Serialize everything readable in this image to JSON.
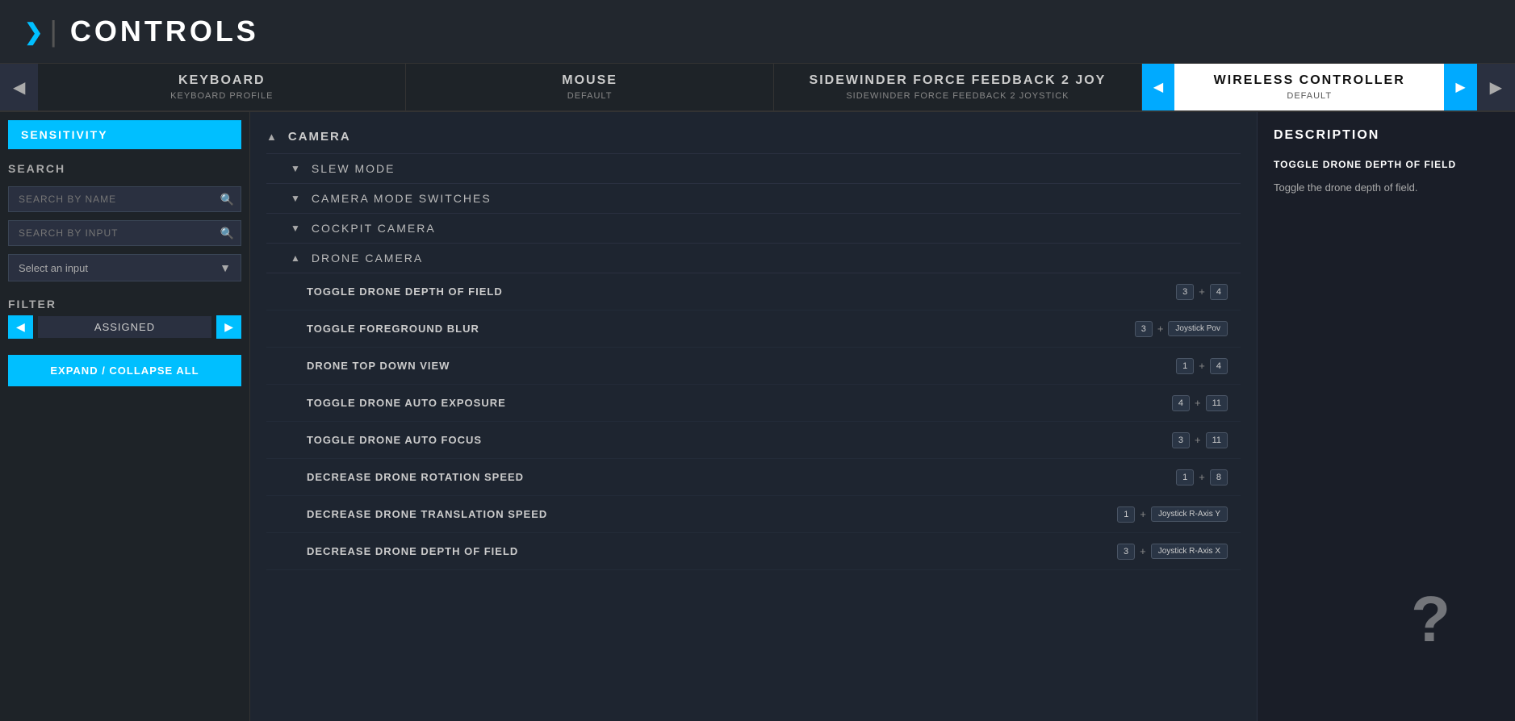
{
  "header": {
    "chevron": "❯",
    "divider": "|",
    "title": "CONTROLS"
  },
  "tabs": [
    {
      "id": "keyboard",
      "name": "KEYBOARD",
      "sub": "KEYBOARD PROFILE",
      "active": false
    },
    {
      "id": "mouse",
      "name": "MOUSE",
      "sub": "DEFAULT",
      "active": false
    },
    {
      "id": "sidewinder",
      "name": "SIDEWINDER FORCE FEEDBACK 2 JOY",
      "sub": "SIDEWINDER FORCE FEEDBACK 2 JOYSTICK",
      "active": false
    },
    {
      "id": "wireless",
      "name": "WIRELESS CONTROLLER",
      "sub": "DEFAULT",
      "active": true
    }
  ],
  "sidebar": {
    "sensitivity_label": "SENSITIVITY",
    "search_label": "SEARCH",
    "search_by_name_placeholder": "SEARCH BY NAME",
    "search_by_input_placeholder": "SEARCH BY INPUT",
    "select_input_placeholder": "Select an input",
    "filter_label": "FILTER",
    "filter_value": "ASSIGNED",
    "expand_label": "EXPAND / COLLAPSE ALL"
  },
  "categories": [
    {
      "name": "CAMERA",
      "expanded": true,
      "subcategories": [
        {
          "name": "SLEW MODE",
          "expanded": false,
          "items": []
        },
        {
          "name": "CAMERA MODE SWITCHES",
          "expanded": false,
          "items": []
        },
        {
          "name": "COCKPIT CAMERA",
          "expanded": false,
          "items": []
        },
        {
          "name": "DRONE CAMERA",
          "expanded": true,
          "items": [
            {
              "name": "TOGGLE DRONE DEPTH OF FIELD",
              "binding1": "3",
              "plus": "+",
              "binding2": "4",
              "binding2_wide": false
            },
            {
              "name": "TOGGLE FOREGROUND BLUR",
              "binding1": "3",
              "plus": "+",
              "binding2": "Joystick Pov",
              "binding2_wide": true
            },
            {
              "name": "DRONE TOP DOWN VIEW",
              "binding1": "1",
              "plus": "+",
              "binding2": "4",
              "binding2_wide": false
            },
            {
              "name": "TOGGLE DRONE AUTO EXPOSURE",
              "binding1": "4",
              "plus": "+",
              "binding2": "11",
              "binding2_wide": false
            },
            {
              "name": "TOGGLE DRONE AUTO FOCUS",
              "binding1": "3",
              "plus": "+",
              "binding2": "11",
              "binding2_wide": false
            },
            {
              "name": "DECREASE DRONE ROTATION SPEED",
              "binding1": "1",
              "plus": "+",
              "binding2": "8",
              "binding2_wide": false
            },
            {
              "name": "DECREASE DRONE TRANSLATION SPEED",
              "binding1": "1",
              "plus": "+",
              "binding2": "Joystick R-Axis Y",
              "binding2_wide": true
            },
            {
              "name": "DECREASE DRONE DEPTH OF FIELD",
              "binding1": "3",
              "plus": "+",
              "binding2": "Joystick R-Axis X",
              "binding2_wide": true
            }
          ]
        }
      ]
    }
  ],
  "description": {
    "title": "DESCRIPTION",
    "action_name": "TOGGLE DRONE DEPTH OF FIELD",
    "text": "Toggle the drone depth of field."
  },
  "icons": {
    "search": "🔍",
    "chevron_down": "▼",
    "chevron_left": "◀",
    "chevron_right": "▶",
    "expand_up": "▲",
    "collapse_down": "▼",
    "question": "?"
  }
}
